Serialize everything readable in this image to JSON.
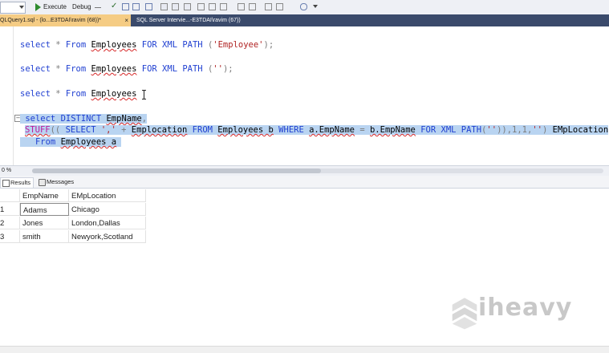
{
  "toolbar": {
    "execute_label": "Execute",
    "debug_label": "Debug"
  },
  "tabs": [
    {
      "label": "QLQuery1.sql - (lo...E3TDAI\\ravim (68))*",
      "close": "×"
    },
    {
      "label": "SQL Server Intervie...-E3TDAI\\ravim (67))",
      "close": ""
    }
  ],
  "editor": {
    "line1": {
      "kw1": "select",
      "op": " * ",
      "kw2": "From",
      "table": "Employees",
      "kw3": "FOR XML PATH",
      "open": " (",
      "str": "'Employee'",
      "close": ");"
    },
    "line2": {
      "kw1": "select",
      "op": " * ",
      "kw2": "From",
      "table": "Employees",
      "kw3": "FOR XML PATH",
      "open": " (",
      "str": "''",
      "close": ");"
    },
    "line3": {
      "kw1": "select",
      "op": " * ",
      "kw2": "From",
      "table": "Employees"
    },
    "line4": {
      "kw1": "select DISTINCT",
      "col": "EmpName",
      "comma": ","
    },
    "line5": {
      "fn": "STUFF",
      "p1": "((",
      "kw1": "SELECT",
      "str1": "','",
      "plus": " + ",
      "col1": "Emplocation",
      "kw2": "FROM",
      "tbl": "Employees b",
      "kw3": "WHERE",
      "c_a": "a.EmpName",
      "eq": " = ",
      "c_b": "b.EmpName",
      "kw4": "FOR XML PATH",
      "p2": "(",
      "str2": "''",
      "p3": ")),1,1,",
      "str3": "''",
      "p4": ")",
      "alias": "EMpLocation"
    },
    "line6": {
      "kw": "From",
      "tbl": "Employees a"
    }
  },
  "zoom": "0 %",
  "results_tabs": [
    {
      "label": "Results"
    },
    {
      "label": "Messages"
    }
  ],
  "grid": {
    "columns": [
      "EmpName",
      "EMpLocation"
    ],
    "rows": [
      {
        "n": "1",
        "EmpName": "Adams",
        "EMpLocation": "Chicago"
      },
      {
        "n": "2",
        "EmpName": "Jones",
        "EMpLocation": "London,Dallas"
      },
      {
        "n": "3",
        "EmpName": "smith",
        "EMpLocation": "Newyork,Scotland"
      }
    ]
  },
  "watermark": "iheavy",
  "colors": {
    "keyword": "#1f3fd1",
    "string": "#b02222",
    "function": "#c0189b",
    "selection": "#b9d4f1",
    "active_tab": "#f5cc84",
    "tab_strip": "#3a4a6b"
  }
}
